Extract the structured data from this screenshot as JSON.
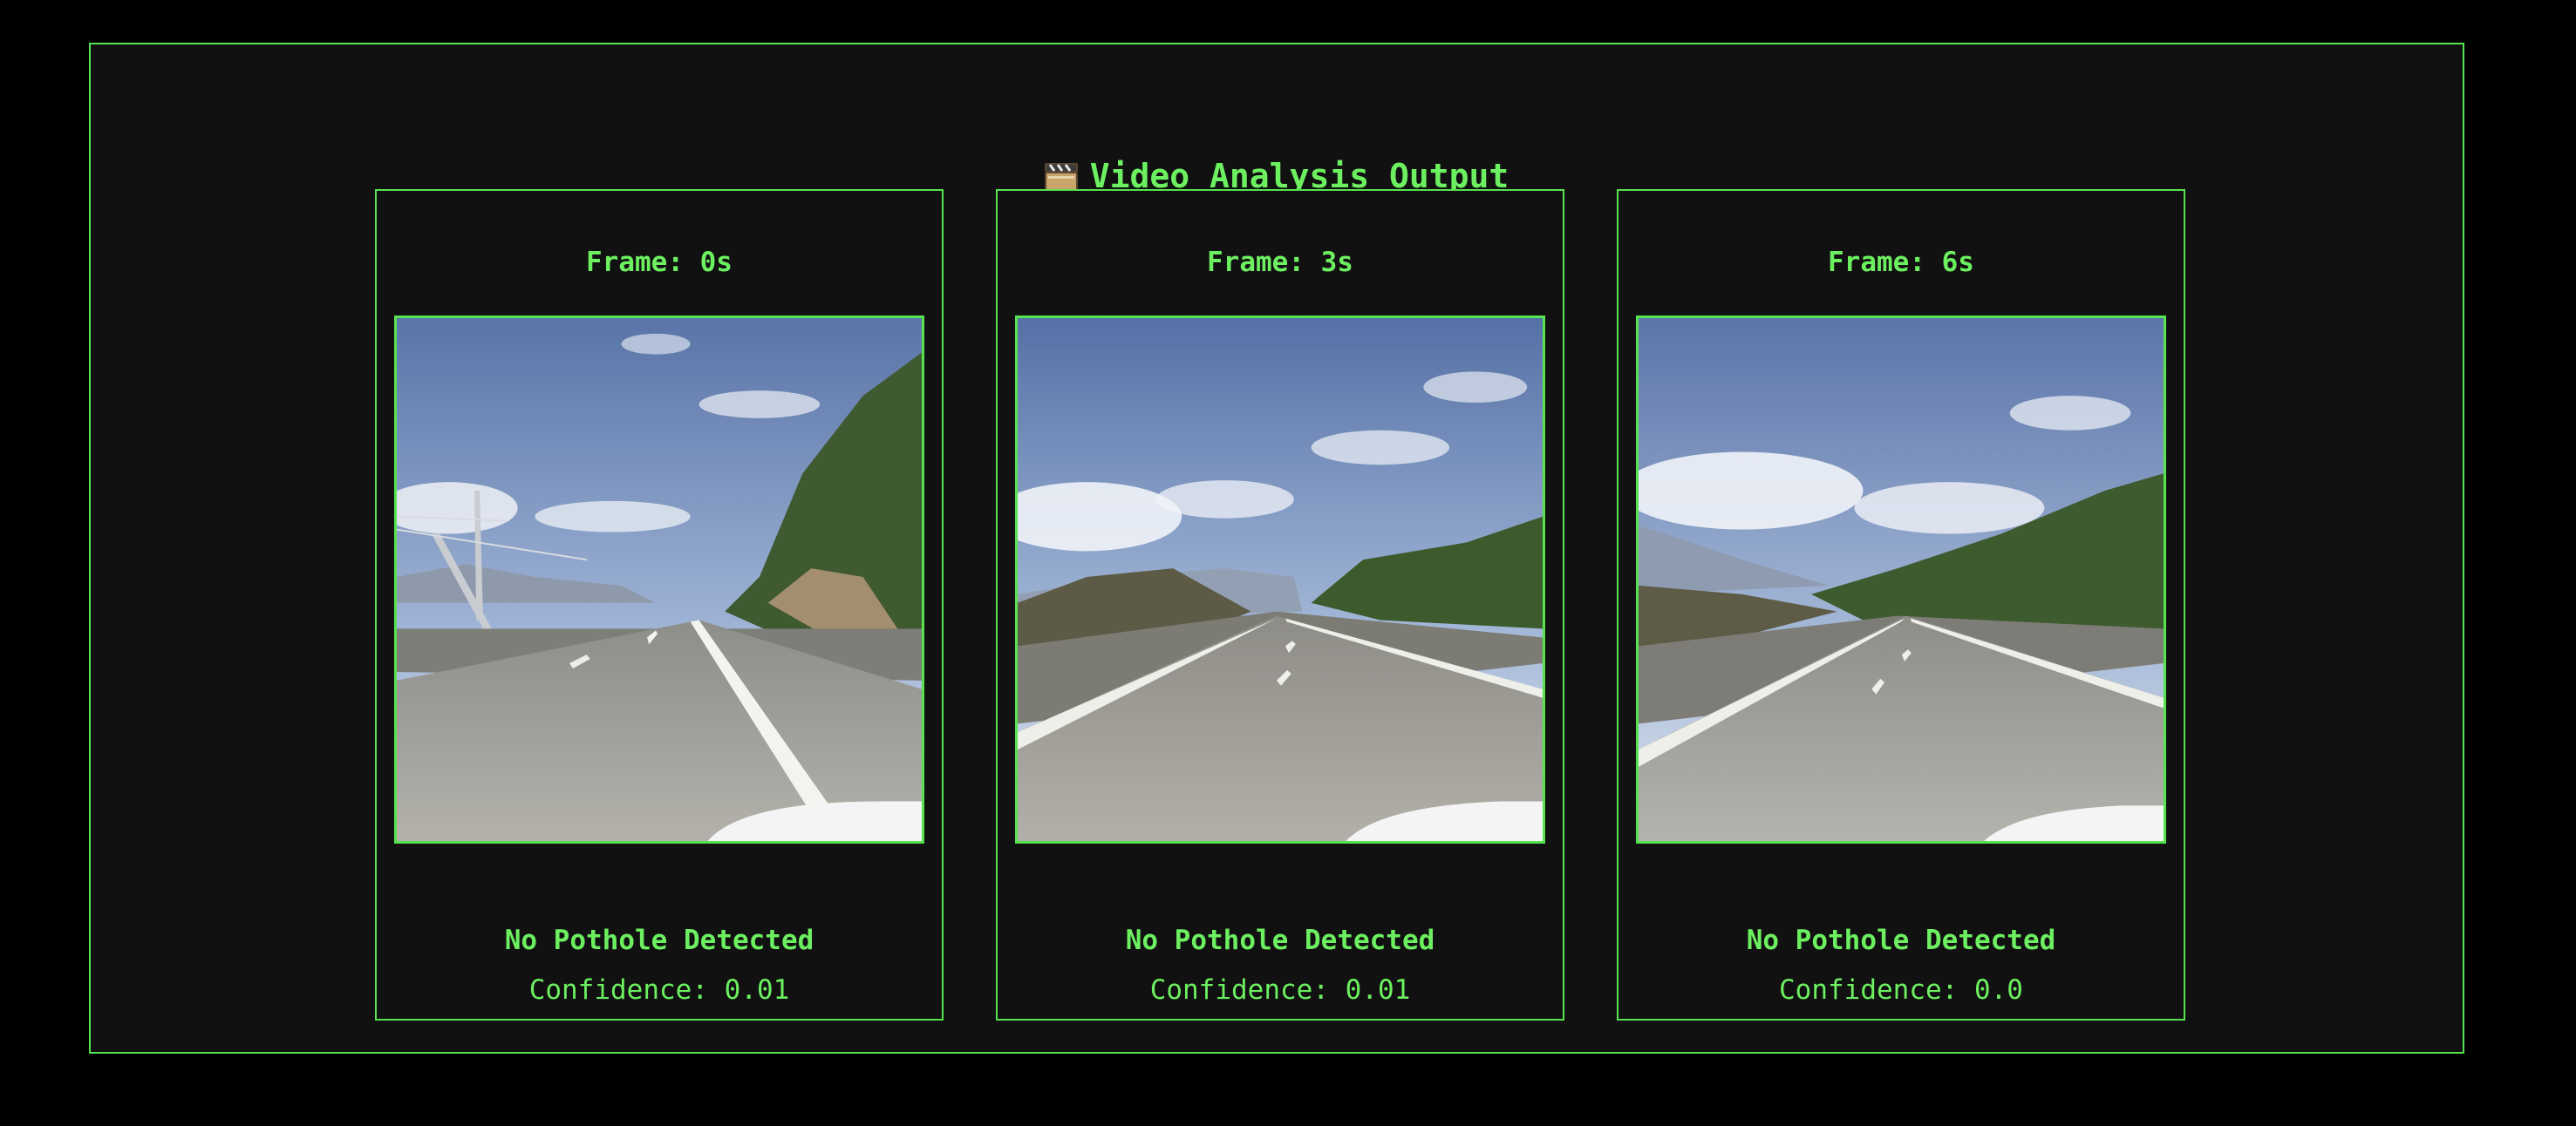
{
  "title": "Video Analysis Output",
  "title_icon": "clapperboard-icon",
  "colors": {
    "accent": "#57e34f",
    "text": "#6cf060",
    "panel_bg": "#111111",
    "page_bg": "#000000"
  },
  "frames": [
    {
      "label": "Frame: 0s",
      "status": "No Pothole Detected",
      "confidence": "Confidence: 0.01"
    },
    {
      "label": "Frame: 3s",
      "status": "No Pothole Detected",
      "confidence": "Confidence: 0.01"
    },
    {
      "label": "Frame: 6s",
      "status": "No Pothole Detected",
      "confidence": "Confidence: 0.0"
    }
  ]
}
